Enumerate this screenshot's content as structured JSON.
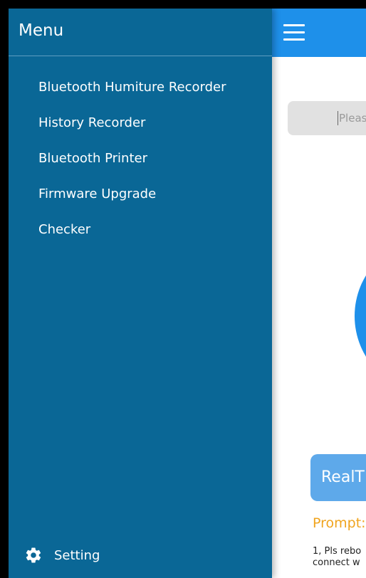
{
  "drawer": {
    "title": "Menu",
    "items": [
      {
        "label": "Bluetooth Humiture Recorder"
      },
      {
        "label": "History Recorder"
      },
      {
        "label": "Bluetooth Printer"
      },
      {
        "label": "Firmware Upgrade"
      },
      {
        "label": "Checker"
      }
    ],
    "setting_label": "Setting",
    "setting_icon": "gear-icon"
  },
  "main": {
    "menu_icon": "hamburger-icon",
    "search_placeholder": "Pleas",
    "realtime_label": "RealT",
    "prompt_title": "Prompt:",
    "prompt_line1": "1, Pls rebo",
    "prompt_line2": "connect w"
  },
  "colors": {
    "drawer_bg": "#0a6796",
    "appbar": "#1e90ea",
    "prompt": "#f0a41e"
  }
}
